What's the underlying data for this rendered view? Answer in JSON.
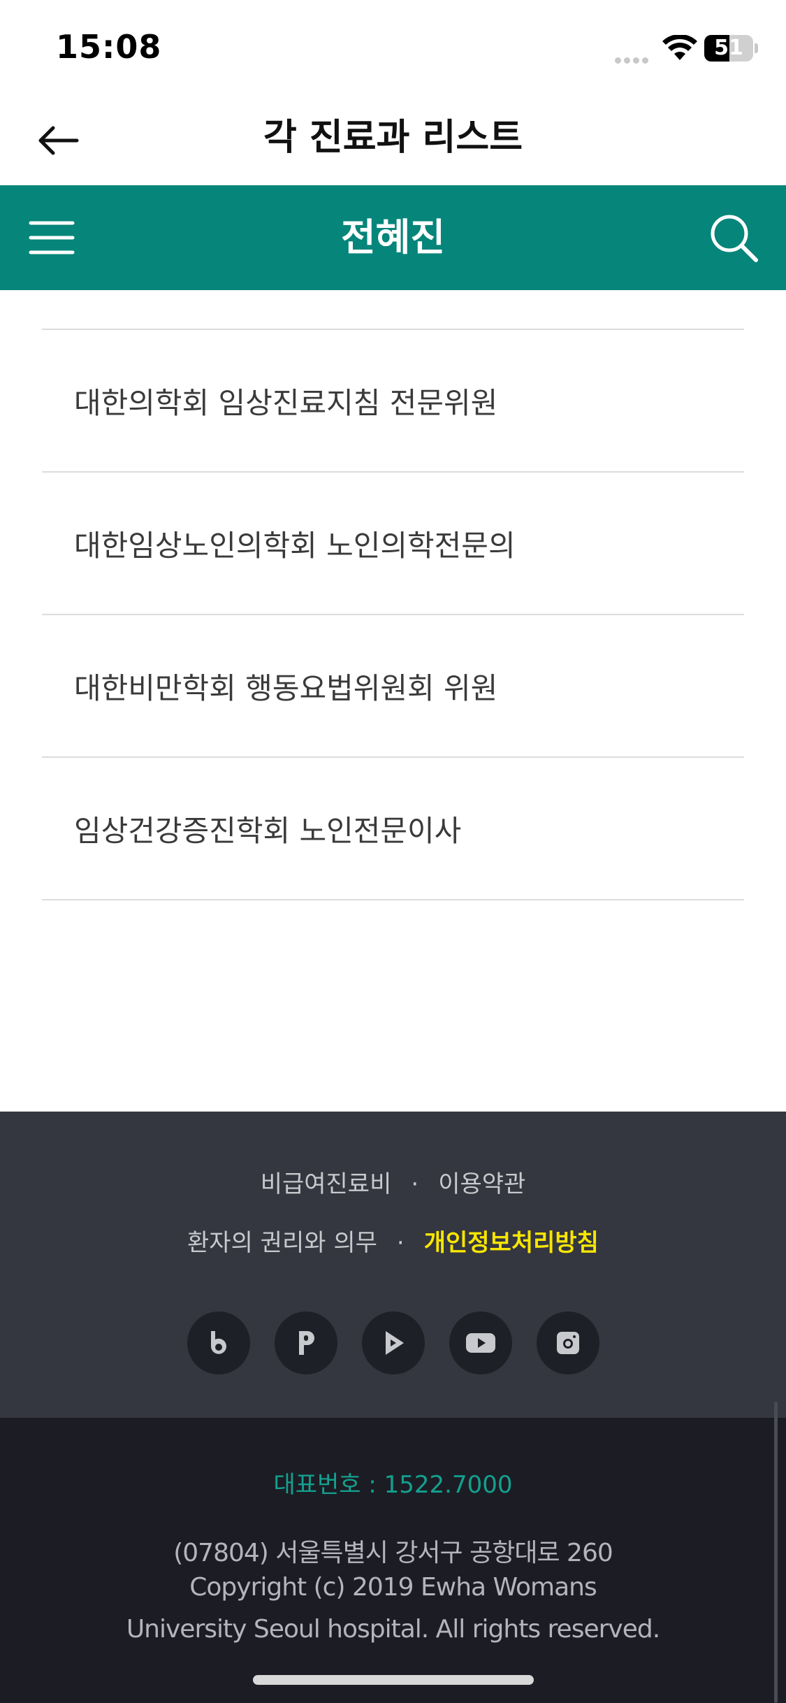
{
  "status_bar": {
    "time": "15:08",
    "battery": "51",
    "battery_level": 0.51
  },
  "title_bar": {
    "title": "각 진료과 리스트"
  },
  "header": {
    "doctor_name": "전혜진"
  },
  "career_list": [
    "대한의학회 임상진료지침 전문위원",
    "대한임상노인의학회 노인의학전문의",
    "대한비만학회 행동요법위원회 위원",
    "임상건강증진학회 노인전문이사"
  ],
  "footer": {
    "links_row1": [
      "비급여진료비",
      "이용약관"
    ],
    "links_row2": [
      "환자의 권리와 의무",
      "개인정보처리방침"
    ],
    "separator": "·",
    "social_icons": [
      "blog-icon",
      "post-icon",
      "play-icon",
      "youtube-icon",
      "instagram-icon"
    ],
    "phone": "대표번호 : 1522.7000",
    "address": "(07804) 서울특별시 강서구 공항대로 260",
    "copyright_1": "Copyright (c) 2019 Ewha Womans",
    "copyright_2": "University Seoul hospital. All rights reserved."
  },
  "colors": {
    "accent": "#06857a",
    "footer_top": "#343640",
    "footer_bottom": "#1c1d24",
    "highlight": "#f7e600",
    "phone": "#14a090"
  }
}
